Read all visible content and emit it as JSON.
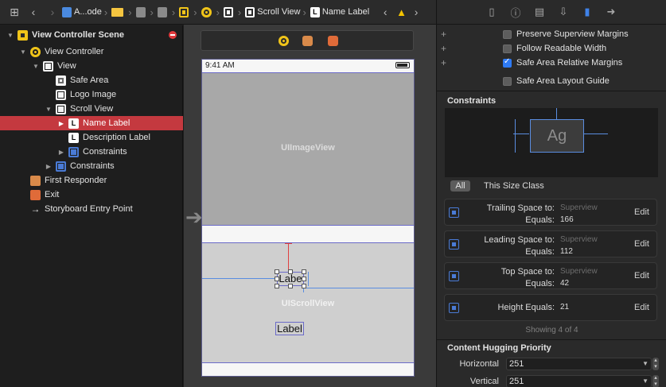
{
  "jumpbar": {
    "crumbs": [
      "A...ode",
      "",
      "",
      "",
      "",
      "",
      "",
      "Scroll View",
      "Name Label"
    ]
  },
  "outline": {
    "items": [
      {
        "label": "View Controller Scene",
        "icon": "storyboard-scene-icon",
        "expanded": true
      },
      {
        "label": "View Controller",
        "icon": "view-controller-icon",
        "expanded": true
      },
      {
        "label": "View",
        "icon": "view-icon",
        "expanded": true
      },
      {
        "label": "Safe Area",
        "icon": "safe-area-icon"
      },
      {
        "label": "Logo Image",
        "icon": "image-view-icon"
      },
      {
        "label": "Scroll View",
        "icon": "scroll-view-icon",
        "expanded": true
      },
      {
        "label": "Name Label",
        "icon": "label-icon",
        "selected": true
      },
      {
        "label": "Description Label",
        "icon": "label-icon"
      },
      {
        "label": "Constraints",
        "icon": "constraints-icon"
      },
      {
        "label": "Constraints",
        "icon": "constraints-icon"
      },
      {
        "label": "First Responder",
        "icon": "first-responder-icon"
      },
      {
        "label": "Exit",
        "icon": "exit-icon"
      },
      {
        "label": "Storyboard Entry Point",
        "icon": "entry-point-arrow-icon"
      }
    ]
  },
  "canvas": {
    "status_time": "9:41 AM",
    "image_view_caption": "UIImageView",
    "scroll_view_caption": "UIScrollView",
    "name_label_text": "Labe",
    "description_label_text": "Label"
  },
  "inspector": {
    "options": [
      {
        "label": "Preserve Superview Margins",
        "checked": false,
        "has_plus": true
      },
      {
        "label": "Follow Readable Width",
        "checked": false,
        "has_plus": true
      },
      {
        "label": "Safe Area Relative Margins",
        "checked": true,
        "has_plus": true
      },
      {
        "label": "Safe Area Layout Guide",
        "checked": false,
        "has_plus": false
      }
    ],
    "constraints_title": "Constraints",
    "constraints_preview_text": "Ag",
    "filter_all": "All",
    "filter_size_class": "This Size Class",
    "constraints": [
      {
        "key": "Trailing Space to:",
        "target": "Superview",
        "equals_label": "Equals:",
        "value": "166",
        "edit": "Edit"
      },
      {
        "key": "Leading Space to:",
        "target": "Superview",
        "equals_label": "Equals:",
        "value": "112",
        "edit": "Edit"
      },
      {
        "key": "Top Space to:",
        "target": "Superview",
        "equals_label": "Equals:",
        "value": "42",
        "edit": "Edit"
      },
      {
        "key": "Height Equals:",
        "value": "21",
        "edit": "Edit"
      }
    ],
    "showing": "Showing 4 of 4",
    "hugging_title": "Content Hugging Priority",
    "hugging": [
      {
        "key": "Horizontal",
        "value": "251"
      },
      {
        "key": "Vertical",
        "value": "251"
      }
    ]
  },
  "colors": {
    "selection": "#c4393f",
    "accent_blue": "#2f7bf5",
    "constraint_blue": "#5a8de0",
    "warning": "#f3c300"
  }
}
